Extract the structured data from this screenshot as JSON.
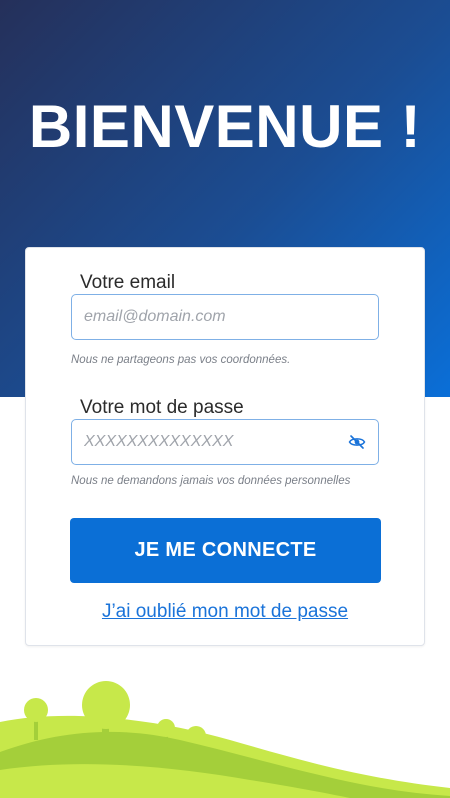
{
  "hero": {
    "title": "BIENVENUE !"
  },
  "login": {
    "email": {
      "label": "Votre email",
      "placeholder": "email@domain.com",
      "value": "",
      "hint": "Nous ne partageons pas vos coordonnées."
    },
    "password": {
      "label": "Votre mot de passe",
      "placeholder": "XXXXXXXXXXXXXX",
      "value": "",
      "hint": "Nous ne demandons jamais vos données personnelles",
      "toggle_icon": "eye-off-icon"
    },
    "submit_label": "JE ME CONNECTE",
    "forgot_label": "J’ai oublié mon mot de passe"
  },
  "colors": {
    "gradient_start": "#25305a",
    "gradient_end": "#0a6fd8",
    "accent": "#0b6fd6",
    "link": "#1a73d9",
    "hill_light": "#c7e84a",
    "hill_dark": "#a4cf3a"
  },
  "decoration": {
    "illustration": "landscape-trees"
  }
}
